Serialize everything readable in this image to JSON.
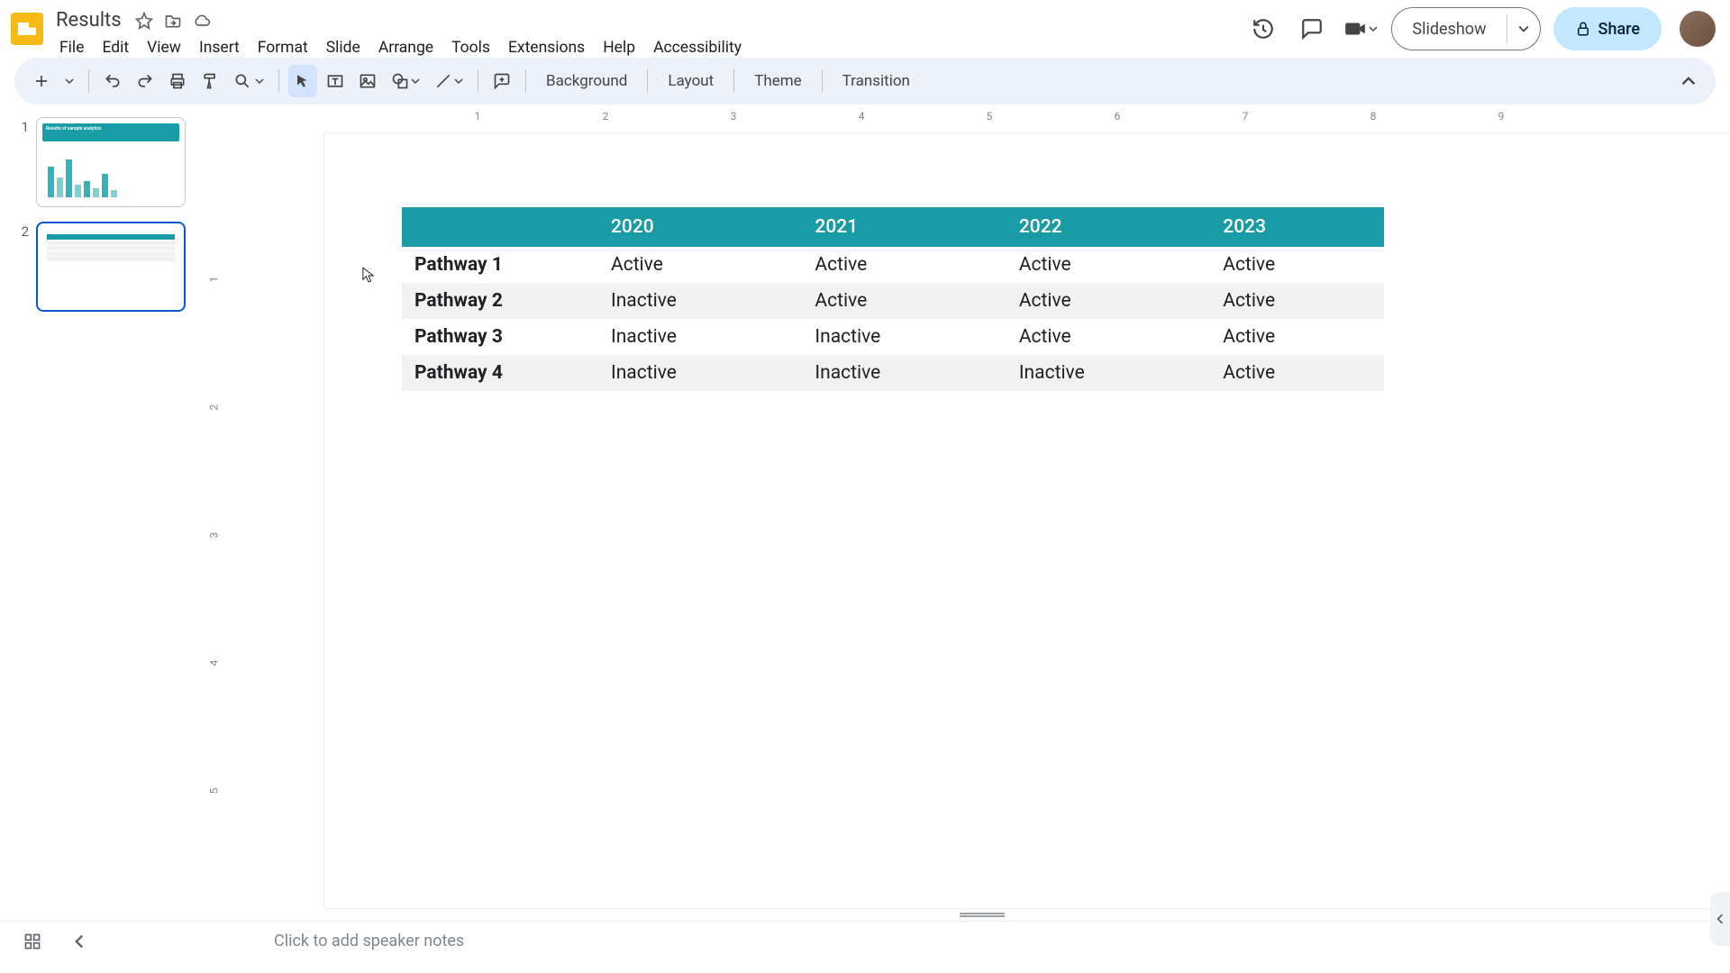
{
  "doc": {
    "title": "Results"
  },
  "menubar": [
    "File",
    "Edit",
    "View",
    "Insert",
    "Format",
    "Slide",
    "Arrange",
    "Tools",
    "Extensions",
    "Help",
    "Accessibility"
  ],
  "header": {
    "slideshow_label": "Slideshow",
    "share_label": "Share"
  },
  "toolbar": {
    "background": "Background",
    "layout": "Layout",
    "theme": "Theme",
    "transition": "Transition"
  },
  "ruler_h": [
    "1",
    "2",
    "3",
    "4",
    "5",
    "6",
    "7",
    "8",
    "9"
  ],
  "ruler_v": [
    "1",
    "2",
    "3",
    "4",
    "5"
  ],
  "thumbs": [
    {
      "num": "1",
      "title": "Results of sample analytics"
    },
    {
      "num": "2"
    }
  ],
  "table": {
    "headers": [
      "",
      "2020",
      "2021",
      "2022",
      "2023"
    ],
    "rows": [
      [
        "Pathway 1",
        "Active",
        "Active",
        "Active",
        "Active"
      ],
      [
        "Pathway 2",
        "Inactive",
        "Active",
        "Active",
        "Active"
      ],
      [
        "Pathway 3",
        "Inactive",
        "Inactive",
        "Active",
        "Active"
      ],
      [
        "Pathway 4",
        "Inactive",
        "Inactive",
        "Inactive",
        "Active"
      ]
    ]
  },
  "notes": {
    "placeholder": "Click to add speaker notes"
  },
  "chart_data": {
    "type": "table",
    "title": "",
    "categories": [
      "2020",
      "2021",
      "2022",
      "2023"
    ],
    "series": [
      {
        "name": "Pathway 1",
        "values": [
          "Active",
          "Active",
          "Active",
          "Active"
        ]
      },
      {
        "name": "Pathway 2",
        "values": [
          "Inactive",
          "Active",
          "Active",
          "Active"
        ]
      },
      {
        "name": "Pathway 3",
        "values": [
          "Inactive",
          "Inactive",
          "Active",
          "Active"
        ]
      },
      {
        "name": "Pathway 4",
        "values": [
          "Inactive",
          "Inactive",
          "Inactive",
          "Active"
        ]
      }
    ]
  }
}
